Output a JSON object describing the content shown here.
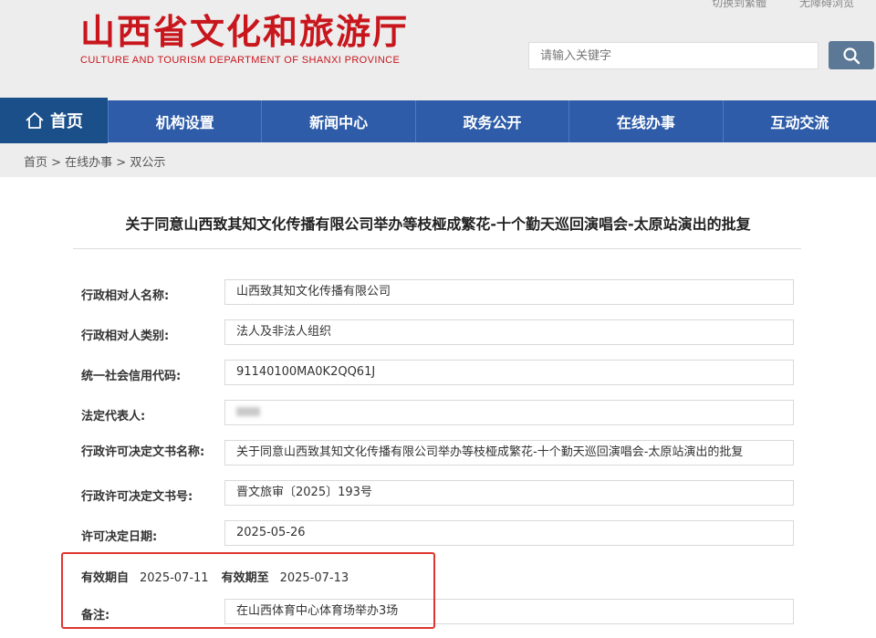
{
  "header": {
    "site_title": "山西省文化和旅游厅",
    "site_title_en": "CULTURE AND TOURISM DEPARTMENT OF SHANXI PROVINCE",
    "top_links": [
      "切换到繁體",
      "无障碍浏览"
    ],
    "search_placeholder": "请输入关键字",
    "brand_color": "#c8161d"
  },
  "nav": {
    "home": "首页",
    "items": [
      "机构设置",
      "新闻中心",
      "政务公开",
      "在线办事",
      "互动交流"
    ]
  },
  "breadcrumb": "首页 > 在线办事 > 双公示",
  "doc": {
    "title": "关于同意山西致其知文化传播有限公司举办等枝桠成繁花-十个勤天巡回演唱会-太原站演出的批复",
    "fields": [
      {
        "label": "行政相对人名称:",
        "value": "山西致其知文化传播有限公司"
      },
      {
        "label": "行政相对人类别:",
        "value": "法人及非法人组织"
      },
      {
        "label": "统一社会信用代码:",
        "value": "91140100MA0K2QQ61J"
      },
      {
        "label": "法定代表人:",
        "value": ""
      },
      {
        "label": "行政许可决定文书名称:",
        "value": "关于同意山西致其知文化传播有限公司举办等枝桠成繁花-十个勤天巡回演唱会-太原站演出的批复"
      },
      {
        "label": "行政许可决定文书号:",
        "value": "晋文旅审〔2025〕193号"
      },
      {
        "label": "许可决定日期:",
        "value": "2025-05-26"
      }
    ],
    "valid_from_label": "有效期自",
    "valid_from": "2025-07-11",
    "valid_to_label": "有效期至",
    "valid_to": "2025-07-13",
    "remark_label": "备注:",
    "remark": "在山西体育中心体育场举办3场"
  }
}
